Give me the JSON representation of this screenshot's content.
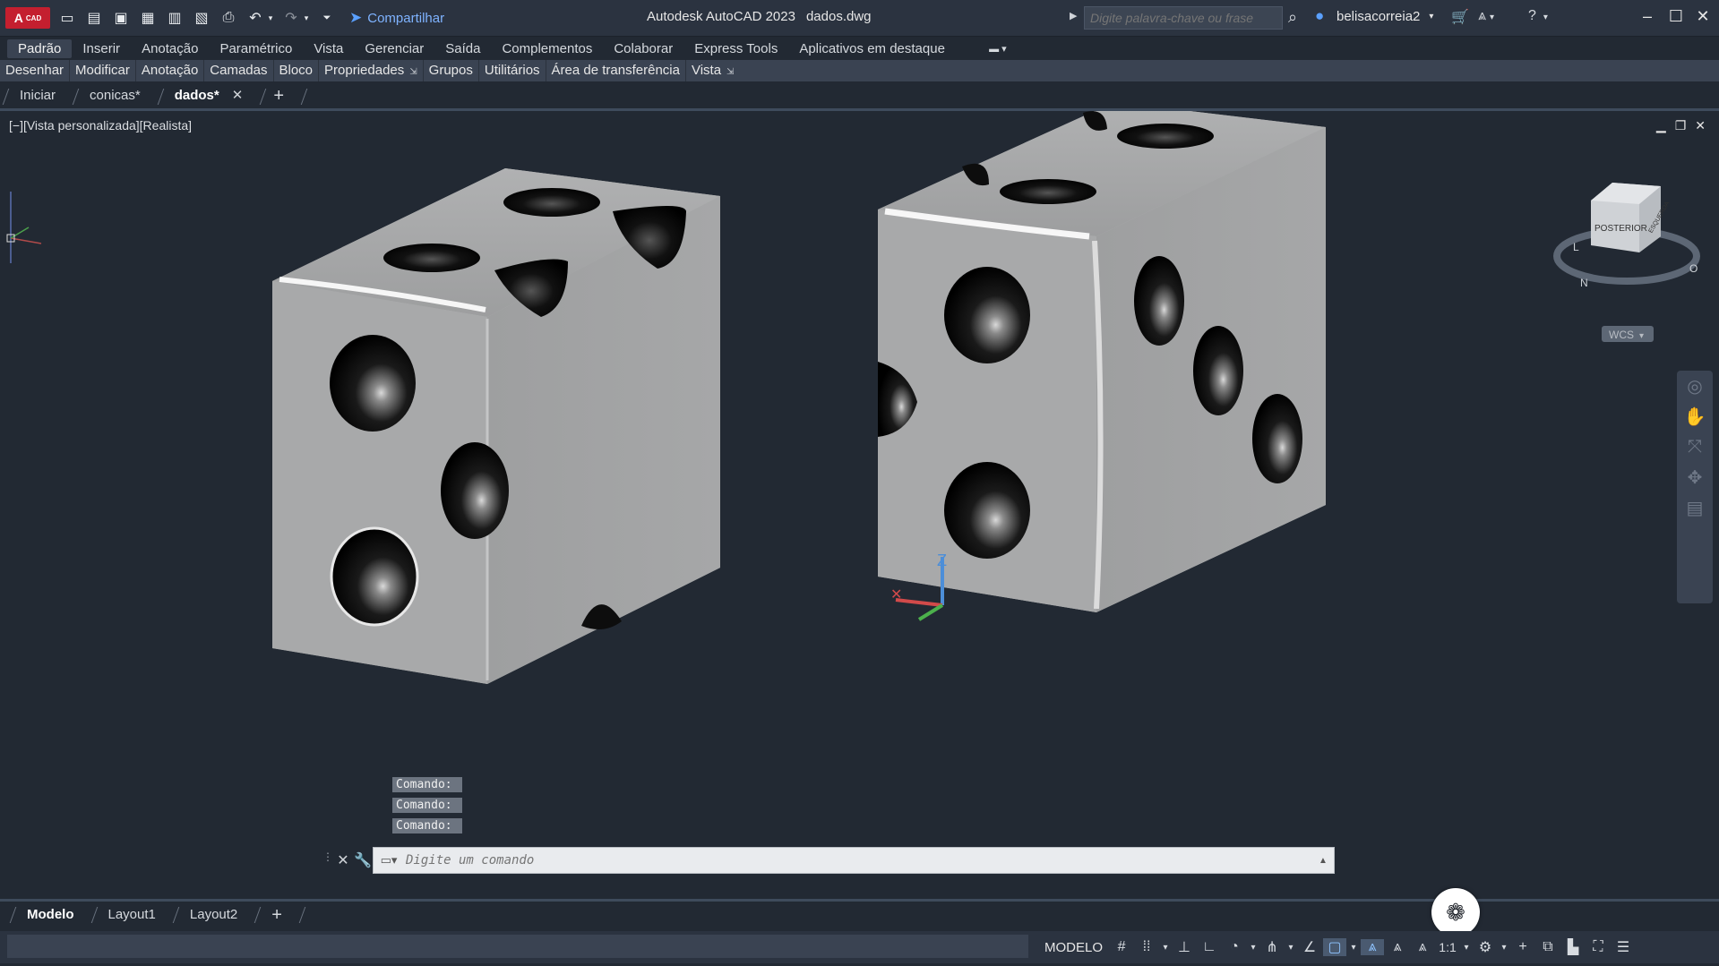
{
  "app": {
    "logo_text": "A",
    "logo_sub": "CAD",
    "title": "Autodesk AutoCAD 2023",
    "filename": "dados.dwg",
    "share_label": "Compartilhar"
  },
  "search": {
    "placeholder": "Digite palavra-chave ou frase"
  },
  "user": {
    "name": "belisacorreia2"
  },
  "menu": [
    "Padrão",
    "Inserir",
    "Anotação",
    "Paramétrico",
    "Vista",
    "Gerenciar",
    "Saída",
    "Complementos",
    "Colaborar",
    "Express Tools",
    "Aplicativos em destaque"
  ],
  "ribbon_panels": [
    "Desenhar",
    "Modificar",
    "Anotação",
    "Camadas",
    "Bloco",
    "Propriedades",
    "Grupos",
    "Utilitários",
    "Área de transferência",
    "Vista"
  ],
  "file_tabs": [
    {
      "label": "Iniciar"
    },
    {
      "label": "conicas*"
    },
    {
      "label": "dados*"
    }
  ],
  "viewport": {
    "label": "[−][Vista personalizada][Realista]",
    "viewcube_face": "POSTERIOR",
    "viewcube_face2": "ESQUERDA",
    "compass_n": "N",
    "compass_o": "O",
    "compass_l": "L",
    "wcs": "WCS",
    "ucs_z": "Z"
  },
  "command": {
    "history": [
      "Comando:",
      "Comando:",
      "Comando:"
    ],
    "placeholder": "Digite um comando"
  },
  "layout_tabs": [
    "Modelo",
    "Layout1",
    "Layout2"
  ],
  "status": {
    "model": "MODELO",
    "scale": "1:1"
  },
  "colors": {
    "background": "#222933",
    "accent": "#5aa0ff",
    "logo": "#c41f2f"
  }
}
